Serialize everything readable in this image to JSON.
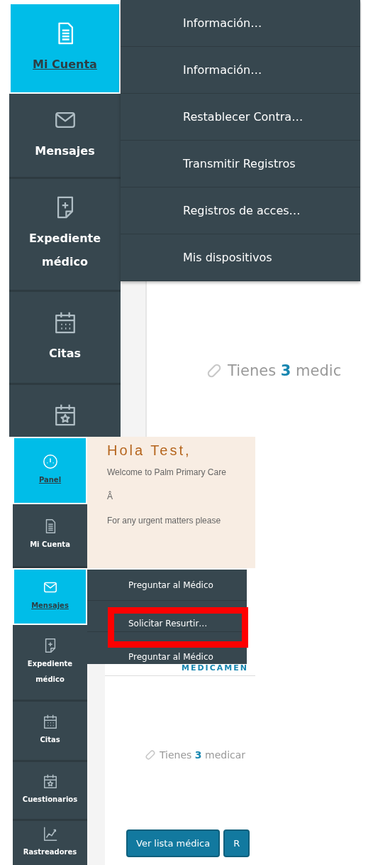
{
  "screen_1": {
    "sidebar": [
      {
        "label": "Mi Cuenta",
        "kind": "document",
        "selected": true
      },
      {
        "label": "Mensajes",
        "kind": "envelope",
        "selected": false
      },
      {
        "label": "Expediente médico",
        "kind": "document-plus",
        "selected": false
      },
      {
        "label": "Citas",
        "kind": "calendar",
        "selected": false
      },
      {
        "kind": "calendar-star",
        "selected": false
      }
    ],
    "account_menu": [
      "Información…",
      "Información…",
      "Restablecer Contra…",
      "Transmitir Registros",
      "Registros de acces…",
      "Mis dispositivos"
    ],
    "medication_note": "Tienes **3** medic"
  },
  "screen_2": {
    "sidebar": [
      {
        "label": "Panel",
        "kind": "gauge",
        "selected": true
      },
      {
        "label": "Mi Cuenta",
        "kind": "document",
        "selected": false
      },
      {
        "label": "Mensajes",
        "kind": "envelope",
        "selected": true
      },
      {
        "label": "Expediente médico",
        "kind": "document-plus",
        "selected": false
      },
      {
        "label": "Citas",
        "kind": "calendar",
        "selected": false
      },
      {
        "label": "Cuestionarios",
        "kind": "calendar-star",
        "selected": false
      },
      {
        "label": "Rastreadores",
        "kind": "chart",
        "selected": false
      }
    ],
    "welcome": {
      "title": "Hola Test,",
      "lines": [
        "Welcome to Palm Primary Care",
        "Â",
        "For any urgent matters please"
      ]
    },
    "messages_menu": [
      "Preguntar al Médico",
      "Solicitar Resurtir…",
      "Preguntar al Médico"
    ],
    "medications": {
      "heading": "MEDICAMEN",
      "note": "Tienes **3** medicar",
      "buttons": [
        "Ver lista médica",
        "R"
      ]
    }
  }
}
